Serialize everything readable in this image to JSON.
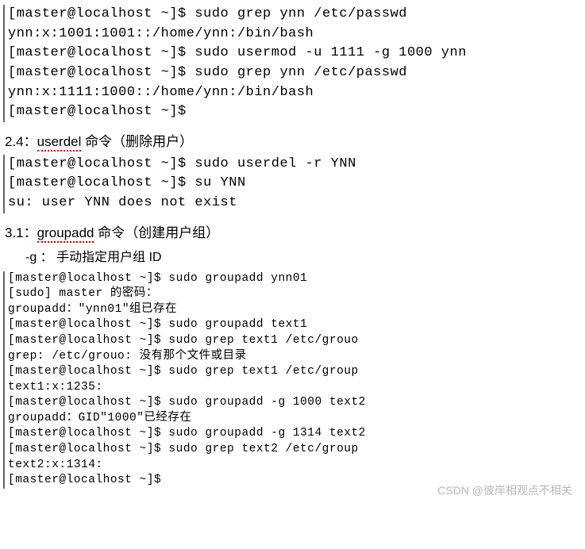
{
  "block1": {
    "lines": [
      "[master@localhost ~]$ sudo grep ynn /etc/passwd",
      "ynn:x:1001:1001::/home/ynn:/bin/bash",
      "[master@localhost ~]$ sudo usermod -u 1111 -g 1000 ynn",
      "[master@localhost ~]$ sudo grep ynn /etc/passwd",
      "ynn:x:1111:1000::/home/ynn:/bin/bash",
      "[master@localhost ~]$"
    ]
  },
  "heading24": {
    "prefix": "2.4：",
    "cmd": "userdel",
    "suffix": " 命令（删除用户）"
  },
  "block2": {
    "lines": [
      "[master@localhost ~]$ sudo userdel -r YNN",
      "[master@localhost ~]$ su YNN",
      "su: user YNN does not exist"
    ]
  },
  "heading31": {
    "prefix": "3.1：",
    "cmd": "groupadd",
    "suffix": " 命令（创建用户组）"
  },
  "sub31": "-g ： 手动指定用户组 ID",
  "block3": {
    "lines": [
      "[master@localhost ~]$ sudo groupadd ynn01",
      "[sudo] master 的密码：",
      "groupadd：\"ynn01\"组已存在",
      "[master@localhost ~]$ sudo groupadd text1",
      "[master@localhost ~]$ sudo grep text1 /etc/grouo",
      "grep: /etc/grouo: 没有那个文件或目录",
      "[master@localhost ~]$ sudo grep text1 /etc/group",
      "text1:x:1235:",
      "[master@localhost ~]$ sudo groupadd -g 1000 text2",
      "groupadd：GID\"1000\"已经存在",
      "[master@localhost ~]$ sudo groupadd -g 1314 text2",
      "[master@localhost ~]$ sudo grep text2 /etc/group",
      "text2:x:1314:",
      "[master@localhost ~]$"
    ]
  },
  "watermark": "CSDN @彼岸相观点不相关"
}
